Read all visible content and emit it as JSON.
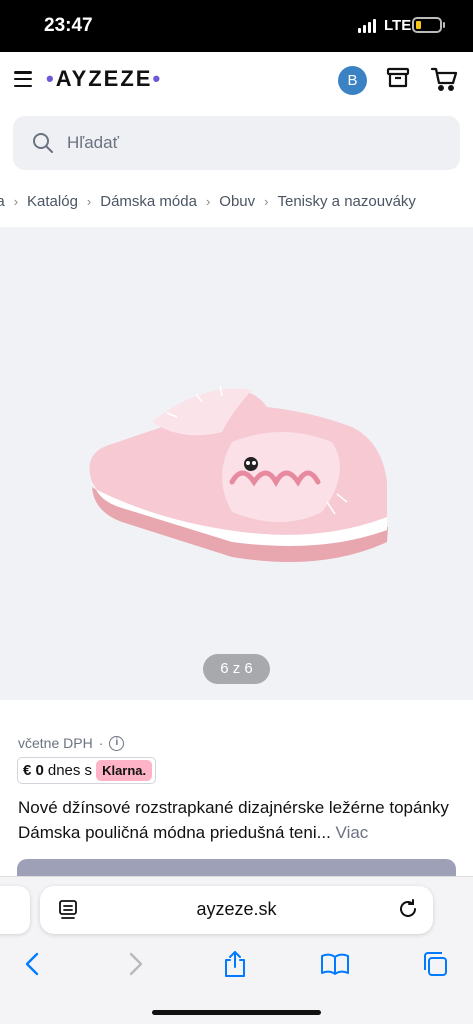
{
  "status_bar": {
    "time": "23:47",
    "network": "LTE",
    "battery_color": "#f5c518"
  },
  "header": {
    "logo": "AYZEZE",
    "logo_dot_color": "#6b5bd6",
    "avatar_initial": "B",
    "avatar_color": "#3b82c4",
    "icons": [
      "menu-icon",
      "archive-icon",
      "cart-icon"
    ]
  },
  "search": {
    "placeholder": "Hľadať",
    "value": ""
  },
  "breadcrumb": [
    "na",
    "Katalóg",
    "Dámska móda",
    "Obuv",
    "Tenisky a nazouváky"
  ],
  "gallery": {
    "counter": "6 z 6",
    "image_alt": "pink sneaker"
  },
  "product": {
    "vat_text": "včetne DPH",
    "vat_separator": "·",
    "installment_price": "€ 0",
    "installment_text": "dnes s",
    "klarna_label": "Klarna.",
    "klarna_color": "#ffb3c7",
    "title": "Nové džínsové rozstrapkané dizajnérske ležérne topánky Dámska pouličná módna priedušná teni...",
    "more_label": "Viac"
  },
  "browser": {
    "url": "ayzeze.sk",
    "toolbar": [
      "back-icon",
      "forward-icon",
      "share-icon",
      "bookmarks-icon",
      "tabs-icon"
    ],
    "accent_color": "#007aff"
  }
}
